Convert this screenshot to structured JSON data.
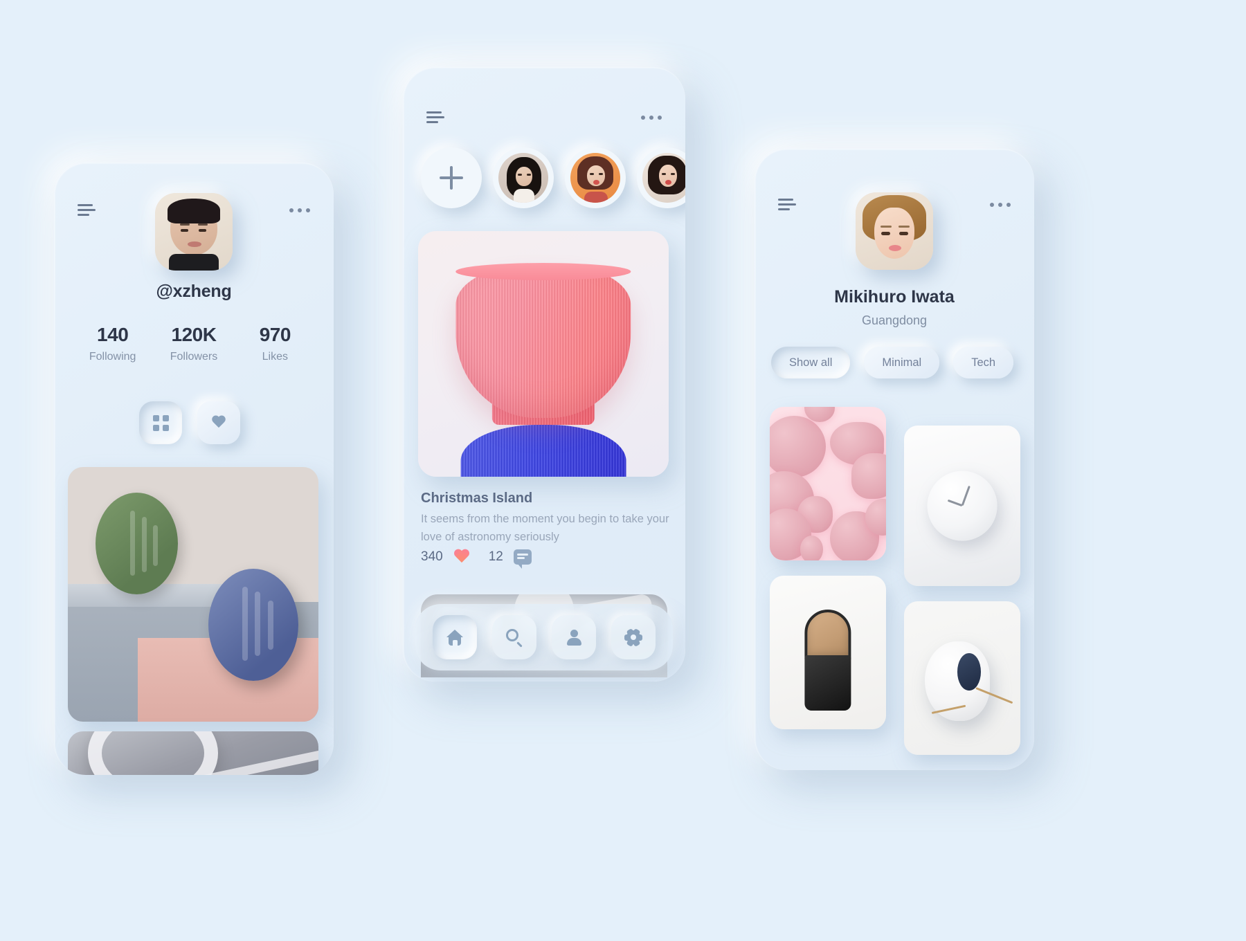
{
  "app": {
    "background_color": "#e4f0fa",
    "accent_color": "#8aa3bd",
    "text_dark": "#2e3648",
    "text_muted": "#8391a6"
  },
  "profile_screen": {
    "menu_icon": "hamburger-menu-icon",
    "more_icon": "more-options-icon",
    "avatar": "user-avatar",
    "username": "@xzheng",
    "stats": [
      {
        "value": "140",
        "label": "Following"
      },
      {
        "value": "120K",
        "label": "Followers"
      },
      {
        "value": "970",
        "label": "Likes"
      }
    ],
    "tabs": [
      {
        "icon": "grid-icon",
        "name": "grid-view-tab",
        "selected": true
      },
      {
        "icon": "heart-icon",
        "name": "liked-view-tab",
        "selected": false
      }
    ],
    "gallery": [
      {
        "name": "still-life-green-blue-photo"
      },
      {
        "name": "grey-abstract-photo"
      }
    ]
  },
  "feed_screen": {
    "menu_icon": "hamburger-menu-icon",
    "more_icon": "more-options-icon",
    "stories": [
      {
        "name": "add-story-button",
        "icon": "plus-icon",
        "label": "Add"
      },
      {
        "name": "story-avatar-1"
      },
      {
        "name": "story-avatar-2"
      },
      {
        "name": "story-avatar-3"
      }
    ],
    "post": {
      "image_name": "3d-vase-render-photo",
      "title": "Christmas Island",
      "description": "It seems from the moment you begin to take your love of astronomy seriously",
      "description_line1": "It seems from the moment you begin to take your",
      "description_line2": "love of astronomy seriously",
      "likes": "340",
      "like_icon": "heart-icon",
      "comments": "12",
      "comment_icon": "comment-bubble-icon"
    },
    "next_post_preview": {
      "name": "next-post-preview-image"
    },
    "bottom_nav": [
      {
        "icon": "home-icon",
        "name": "nav-home",
        "active": true
      },
      {
        "icon": "search-icon",
        "name": "nav-search",
        "active": false
      },
      {
        "icon": "person-icon",
        "name": "nav-profile",
        "active": false
      },
      {
        "icon": "gear-icon",
        "name": "nav-settings",
        "active": false
      }
    ]
  },
  "gallery_screen": {
    "menu_icon": "hamburger-menu-icon",
    "more_icon": "more-options-icon",
    "avatar": "user-avatar",
    "name": "Mikihuro Iwata",
    "location": "Guangdong",
    "filters": [
      {
        "label": "Show all",
        "selected": true
      },
      {
        "label": "Minimal",
        "selected": false
      },
      {
        "label": "Tech",
        "selected": false
      }
    ],
    "items": [
      {
        "name": "pink-blobs-tile"
      },
      {
        "name": "white-clock-tile"
      },
      {
        "name": "wood-black-object-tile"
      },
      {
        "name": "white-mouse-tile"
      }
    ]
  }
}
